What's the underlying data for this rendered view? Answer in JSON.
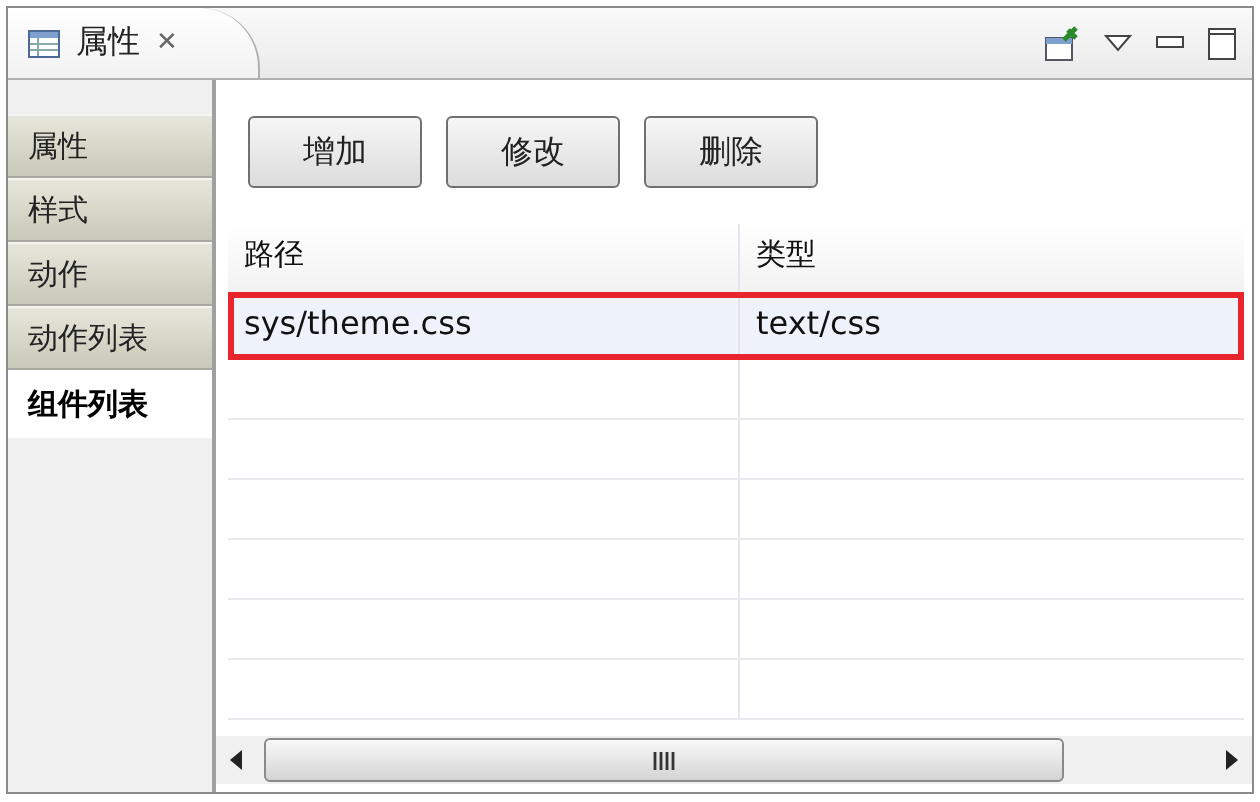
{
  "view_tab": {
    "title": "属性",
    "close": "✕"
  },
  "side_tabs": [
    {
      "label": "属性",
      "selected": false
    },
    {
      "label": "样式",
      "selected": false
    },
    {
      "label": "动作",
      "selected": false
    },
    {
      "label": "动作列表",
      "selected": false
    },
    {
      "label": "组件列表",
      "selected": true
    }
  ],
  "buttons": [
    "增加",
    "修改",
    "删除"
  ],
  "table": {
    "columns": [
      "路径",
      "类型"
    ],
    "rows": [
      {
        "cells": [
          "sys/theme.css",
          "text/css"
        ],
        "selected": true
      }
    ]
  }
}
